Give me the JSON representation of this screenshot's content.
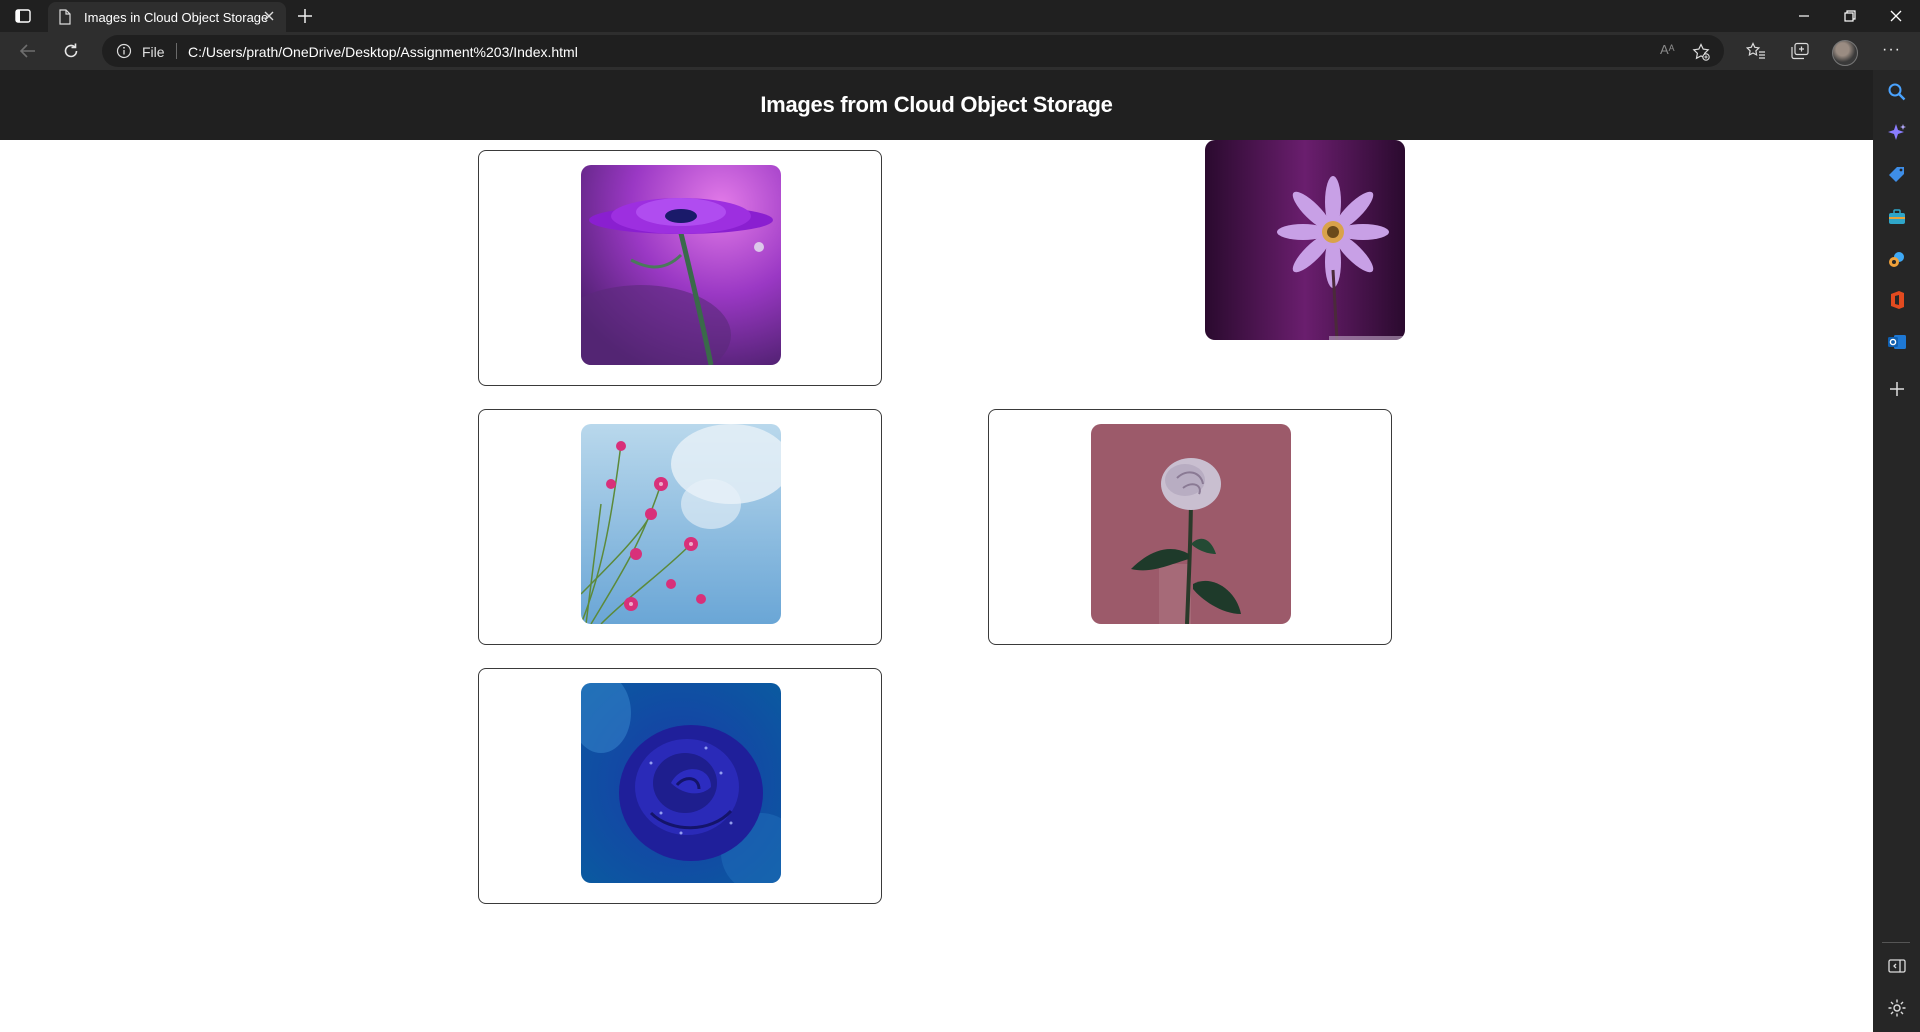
{
  "browser": {
    "tab": {
      "title": "Images in Cloud Object Storage"
    },
    "address": {
      "scheme": "File",
      "url": "C:/Users/prath/OneDrive/Desktop/Assignment%203/Index.html"
    },
    "read_aloud_label": "Aᴬ"
  },
  "page": {
    "title": "Images from Cloud Object Storage",
    "images": [
      {
        "subject": "purple daisy with water droplet"
      },
      {
        "subject": "violet daisy on dark purple background"
      },
      {
        "subject": "pink cosmos flowers against blue sky"
      },
      {
        "subject": "single lavender rose on mauve background"
      },
      {
        "subject": "blue rose with dew drops"
      }
    ]
  }
}
